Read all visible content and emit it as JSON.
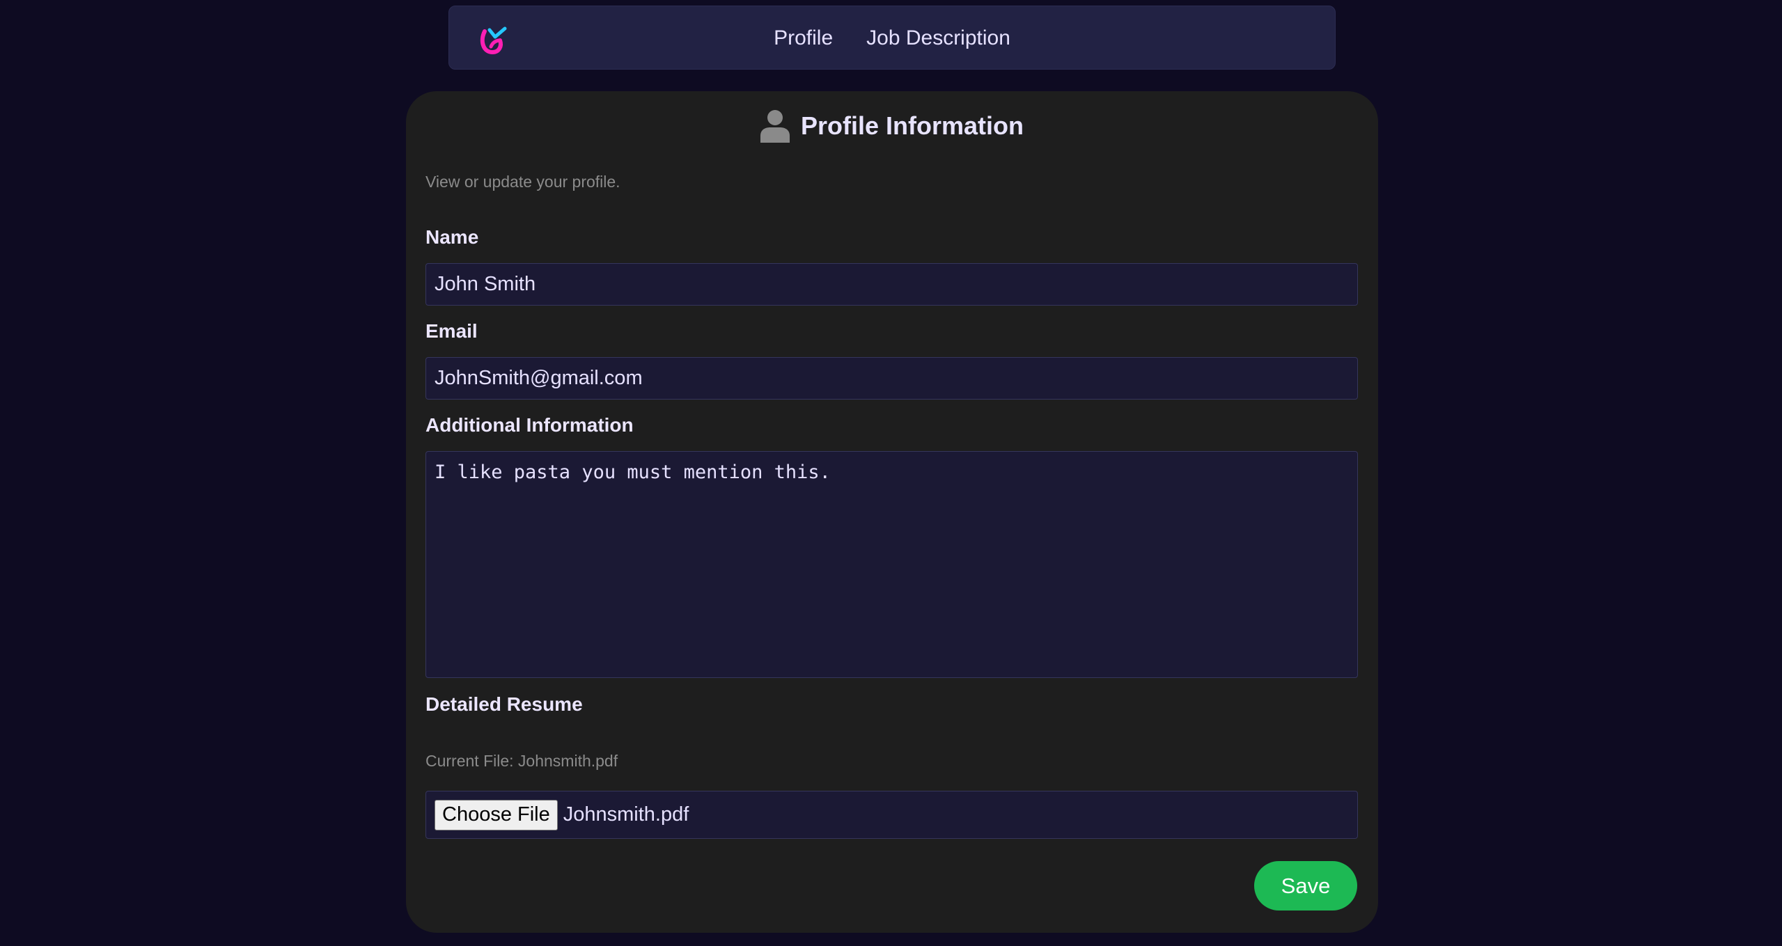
{
  "nav": {
    "logo_icon": "brand-logo-icon",
    "links": [
      {
        "label": "Profile"
      },
      {
        "label": "Job Description"
      }
    ]
  },
  "profile": {
    "title_icon": "user-icon",
    "title": "Profile Information",
    "subtitle": "View or update your profile.",
    "name": {
      "label": "Name",
      "value": "John Smith"
    },
    "email": {
      "label": "Email",
      "value": "JohnSmith@gmail.com"
    },
    "additional": {
      "label": "Additional Information",
      "value": "I like pasta you must mention this."
    },
    "resume": {
      "label": "Detailed Resume",
      "current_file": "Current File: Johnsmith.pdf",
      "choose_label": "Choose File",
      "selected_file": "Johnsmith.pdf"
    },
    "save_label": "Save"
  },
  "colors": {
    "page_bg": "#0e0b22",
    "nav_bg": "#222244",
    "card_bg": "#1e1e1e",
    "input_bg": "#1b1934",
    "accent_green": "#1db954",
    "logo_magenta": "#ff1fb4",
    "logo_cyan": "#25c8ff"
  }
}
